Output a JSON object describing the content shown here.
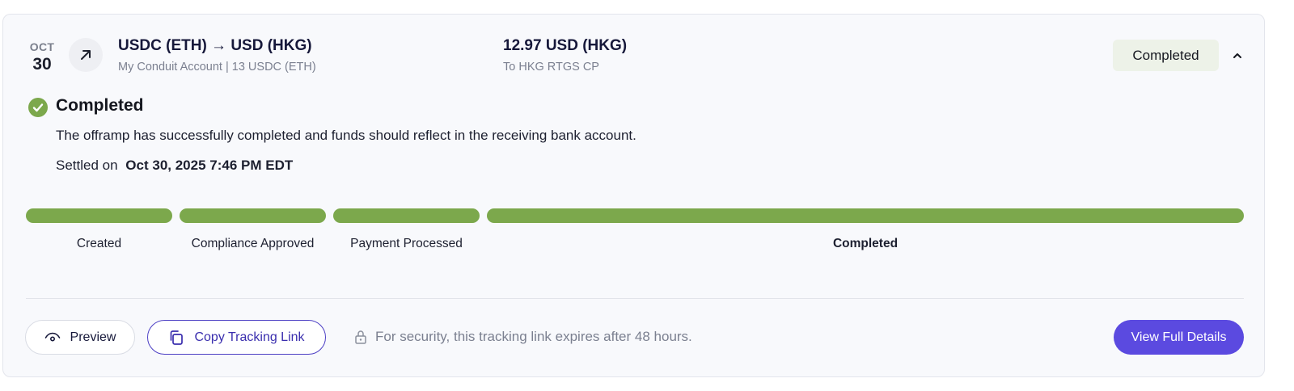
{
  "transaction": {
    "date_month": "OCT",
    "date_day": "30",
    "direction_icon": "arrow-up-right-icon",
    "title": "USDC (ETH) → USD (HKG)",
    "subtitle": "My Conduit Account | 13 USDC (ETH)",
    "amount": "12.97 USD (HKG)",
    "amount_sub": "To HKG RTGS CP",
    "status_badge": "Completed"
  },
  "status": {
    "heading": "Completed",
    "description": "The offramp has successfully completed and funds should reflect in the receiving bank account.",
    "settled_label": "Settled on",
    "settled_value": "Oct 30, 2025 7:46 PM EDT"
  },
  "progress": {
    "steps": [
      {
        "label": "Created",
        "complete": true
      },
      {
        "label": "Compliance Approved",
        "complete": true
      },
      {
        "label": "Payment Processed",
        "complete": true
      },
      {
        "label": "Completed",
        "complete": true
      }
    ],
    "bar_color": "#7ca84c"
  },
  "footer": {
    "preview_label": "Preview",
    "copy_label": "Copy Tracking Link",
    "security_note": "For security, this tracking link expires after 48 hours.",
    "details_label": "View Full Details"
  },
  "colors": {
    "accent": "#5b4ae0",
    "success": "#7ca84c",
    "badge_bg": "#edf2e8"
  }
}
